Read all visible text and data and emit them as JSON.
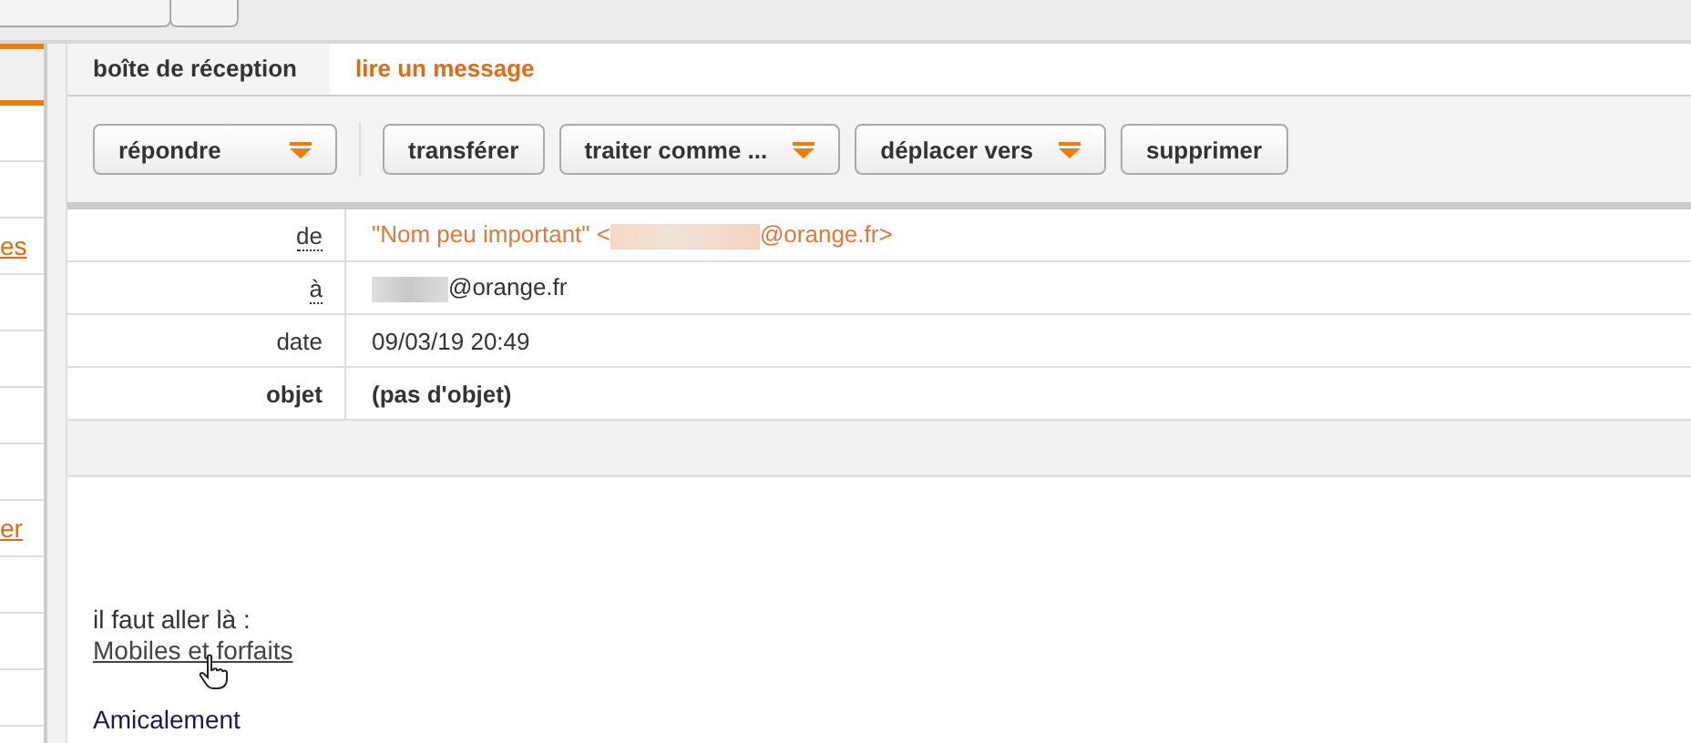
{
  "sidebar": {
    "items": [
      {
        "label": "es"
      },
      {
        "label": "er"
      }
    ]
  },
  "breadcrumb": [
    {
      "label": "boîte de réception",
      "selected": false
    },
    {
      "label": "lire un message",
      "selected": true
    }
  ],
  "toolbar": [
    {
      "label": "répondre",
      "kind": "menu"
    },
    {
      "label": "transférer",
      "kind": "plain"
    },
    {
      "label": "traiter comme ...",
      "kind": "menu"
    },
    {
      "label": "déplacer vers",
      "kind": "menu"
    },
    {
      "label": "supprimer",
      "kind": "plain"
    }
  ],
  "headers": [
    {
      "label": "de",
      "kind": "from",
      "before": "\"Nom peu important\" <",
      "after": "@orange.fr>"
    },
    {
      "label": "à",
      "kind": "to",
      "after": "@orange.fr"
    },
    {
      "label": "date",
      "kind": "plain",
      "value": "09/03/19 20:49"
    },
    {
      "label": "objet",
      "kind": "subject",
      "value": "(pas d'objet)"
    }
  ],
  "body": {
    "intro": "il faut aller là :",
    "link": "Mobiles et forfaits",
    "closing": "Amicalement"
  }
}
